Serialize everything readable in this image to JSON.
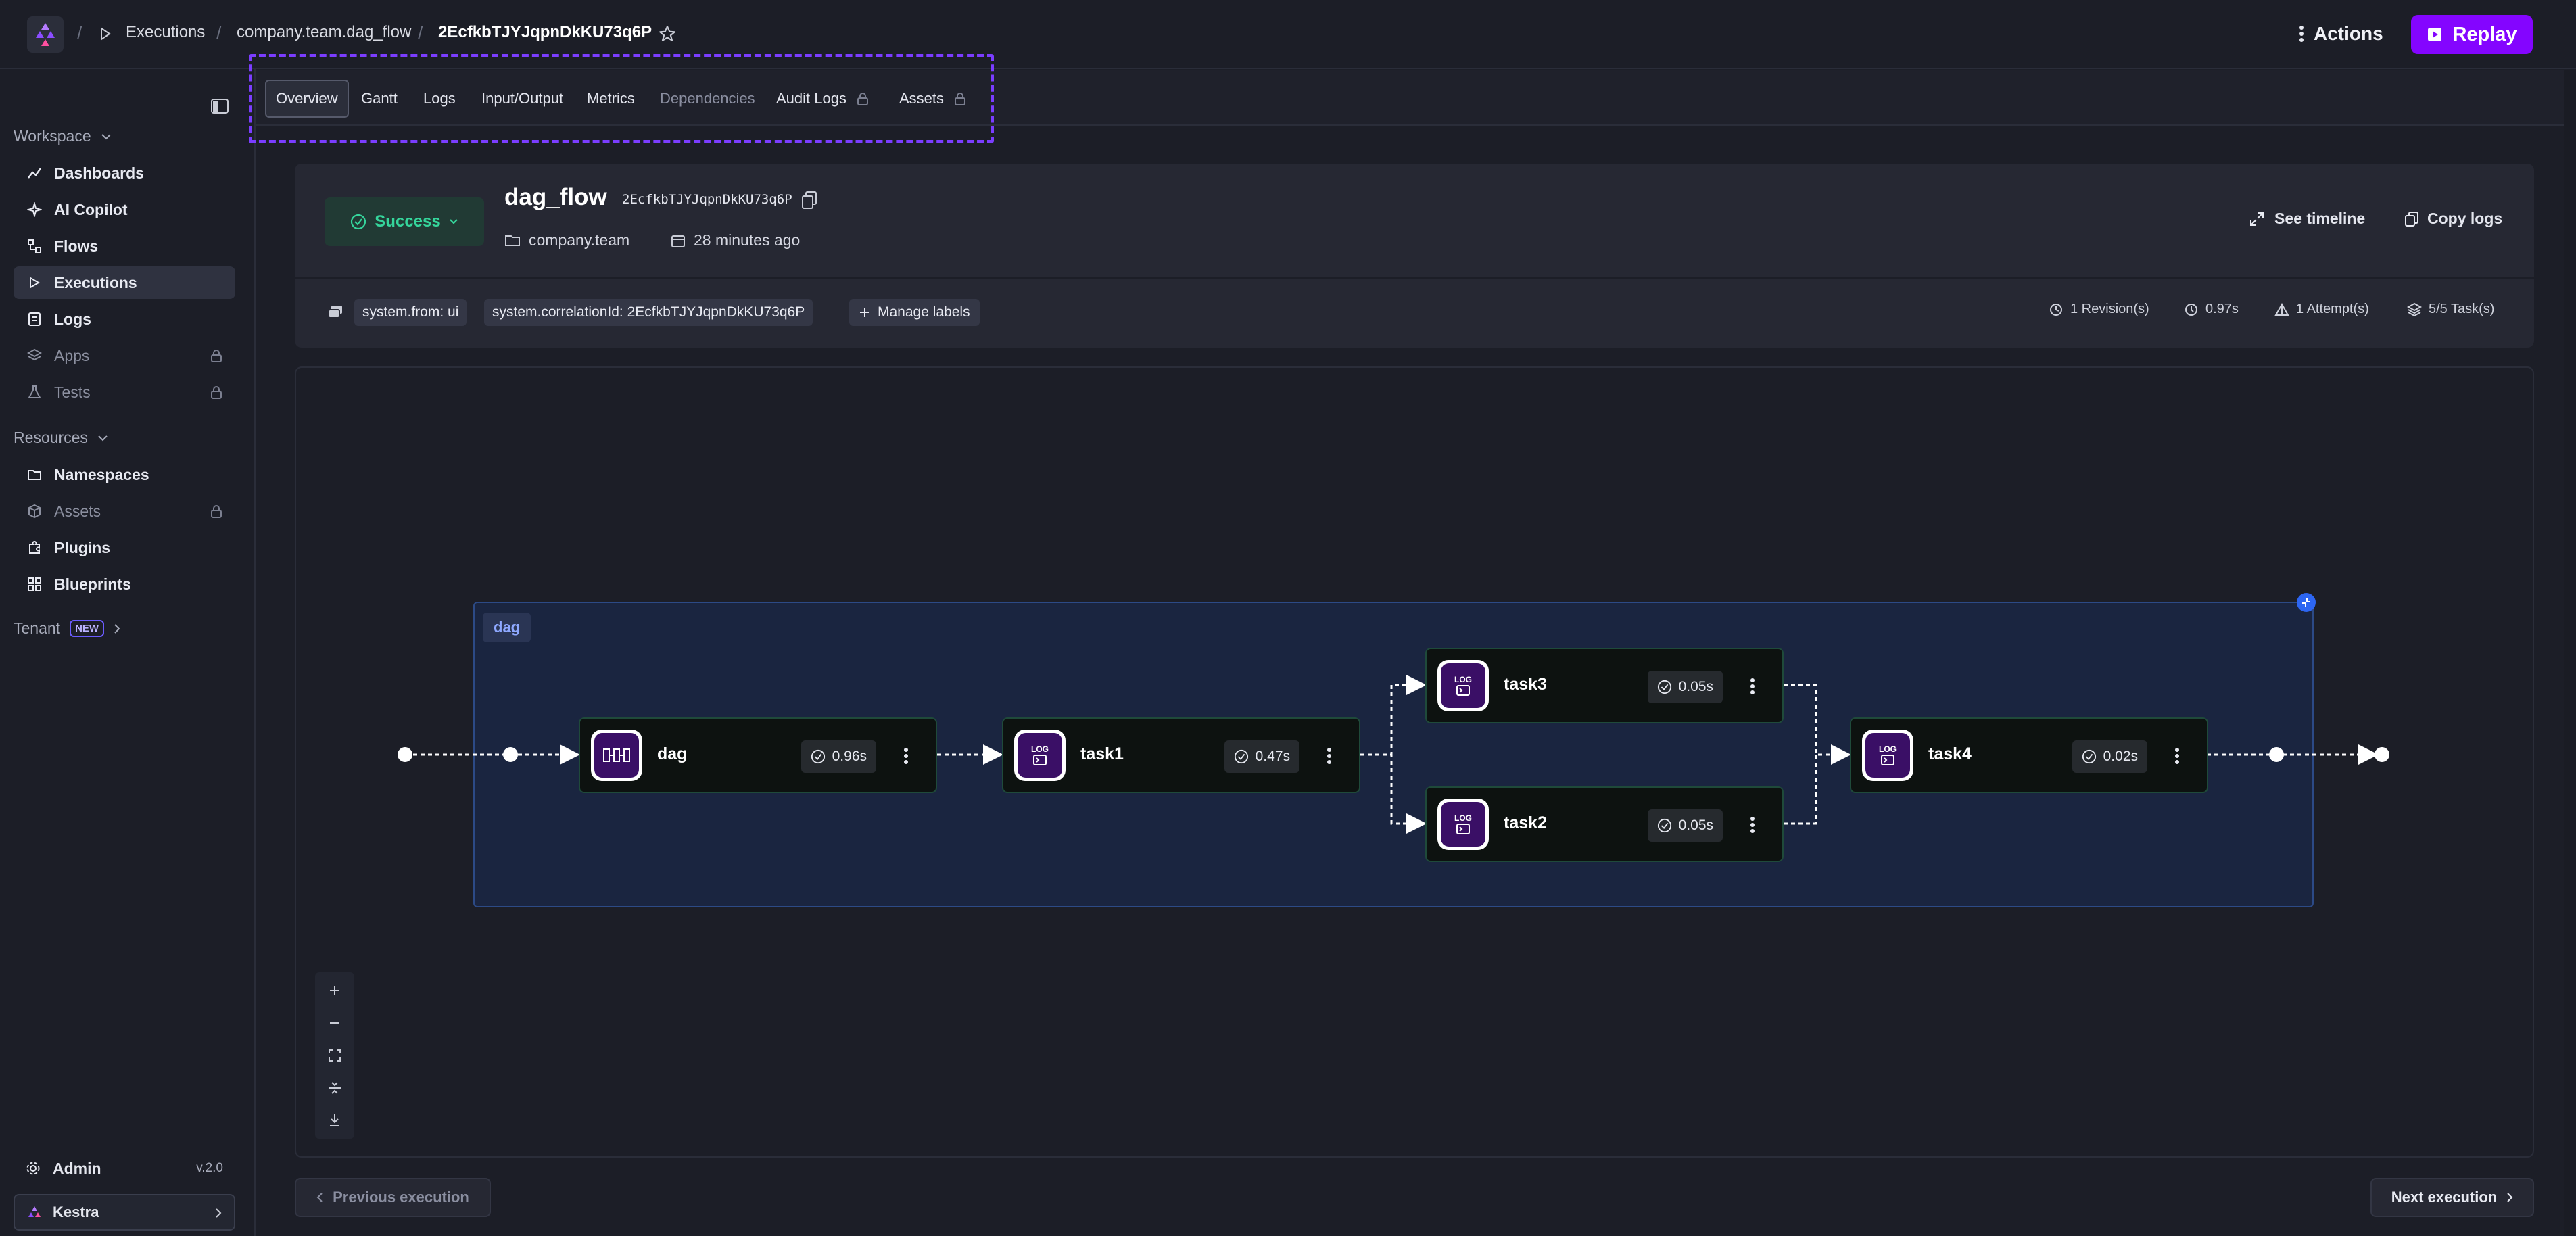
{
  "breadcrumbs": {
    "executions": "Executions",
    "flow": "company.team.dag_flow",
    "execution_id": "2EcfkbTJYJqpnDkKU73q6P"
  },
  "topbar": {
    "actions_label": "Actions",
    "replay_label": "Replay"
  },
  "sidebar": {
    "workspace_label": "Workspace",
    "workspace_items": [
      {
        "label": "Dashboards",
        "icon": "chart-line-icon",
        "locked": false
      },
      {
        "label": "AI Copilot",
        "icon": "ai-sparkle-icon",
        "locked": false
      },
      {
        "label": "Flows",
        "icon": "flow-icon",
        "locked": false
      },
      {
        "label": "Executions",
        "icon": "play-icon",
        "locked": false,
        "active": true
      },
      {
        "label": "Logs",
        "icon": "document-icon",
        "locked": false
      },
      {
        "label": "Apps",
        "icon": "layers-icon",
        "locked": true
      },
      {
        "label": "Tests",
        "icon": "flask-icon",
        "locked": true
      }
    ],
    "resources_label": "Resources",
    "resources_items": [
      {
        "label": "Namespaces",
        "icon": "folder-icon",
        "locked": false
      },
      {
        "label": "Assets",
        "icon": "cube-icon",
        "locked": true
      },
      {
        "label": "Plugins",
        "icon": "puzzle-icon",
        "locked": false
      },
      {
        "label": "Blueprints",
        "icon": "grid-icon",
        "locked": false
      }
    ],
    "tenant_label": "Tenant",
    "tenant_badge": "NEW",
    "admin_label": "Admin",
    "version": "v.2.0",
    "tenant_select": "Kestra"
  },
  "tabs": [
    {
      "label": "Overview",
      "active": true
    },
    {
      "label": "Gantt"
    },
    {
      "label": "Logs"
    },
    {
      "label": "Input/Output"
    },
    {
      "label": "Metrics"
    },
    {
      "label": "Dependencies",
      "muted": true
    },
    {
      "label": "Audit Logs",
      "locked": true
    },
    {
      "label": "Assets",
      "locked": true
    }
  ],
  "header": {
    "status": "Success",
    "status_color": "#35d59b",
    "flow_id": "dag_flow",
    "execution_id": "2EcfkbTJYJqpnDkKU73q6P",
    "namespace": "company.team",
    "relative_time": "28 minutes ago",
    "see_timeline": "See timeline",
    "copy_logs": "Copy logs",
    "labels": [
      "system.from: ui",
      "system.correlationId: 2EcfkbTJYJqpnDkKU73q6P"
    ],
    "manage_labels": "Manage labels",
    "meta": {
      "revisions": "1 Revision(s)",
      "duration": "0.97s",
      "attempts": "1 Attempt(s)",
      "tasks": "5/5 Task(s)"
    }
  },
  "topology": {
    "cluster_label": "dag",
    "nodes": [
      {
        "id": "dag",
        "name": "dag",
        "duration": "0.96s",
        "icon": "dag-task-icon"
      },
      {
        "id": "task1",
        "name": "task1",
        "duration": "0.47s",
        "icon": "log-task-icon",
        "icon_text": "LOG"
      },
      {
        "id": "task3",
        "name": "task3",
        "duration": "0.05s",
        "icon": "log-task-icon",
        "icon_text": "LOG"
      },
      {
        "id": "task2",
        "name": "task2",
        "duration": "0.05s",
        "icon": "log-task-icon",
        "icon_text": "LOG"
      },
      {
        "id": "task4",
        "name": "task4",
        "duration": "0.02s",
        "icon": "log-task-icon",
        "icon_text": "LOG"
      }
    ]
  },
  "footer": {
    "previous": "Previous execution",
    "next": "Next execution"
  },
  "colors": {
    "accent": "#8405ff",
    "success": "#35d59b",
    "cluster_border": "#2c4a86"
  }
}
